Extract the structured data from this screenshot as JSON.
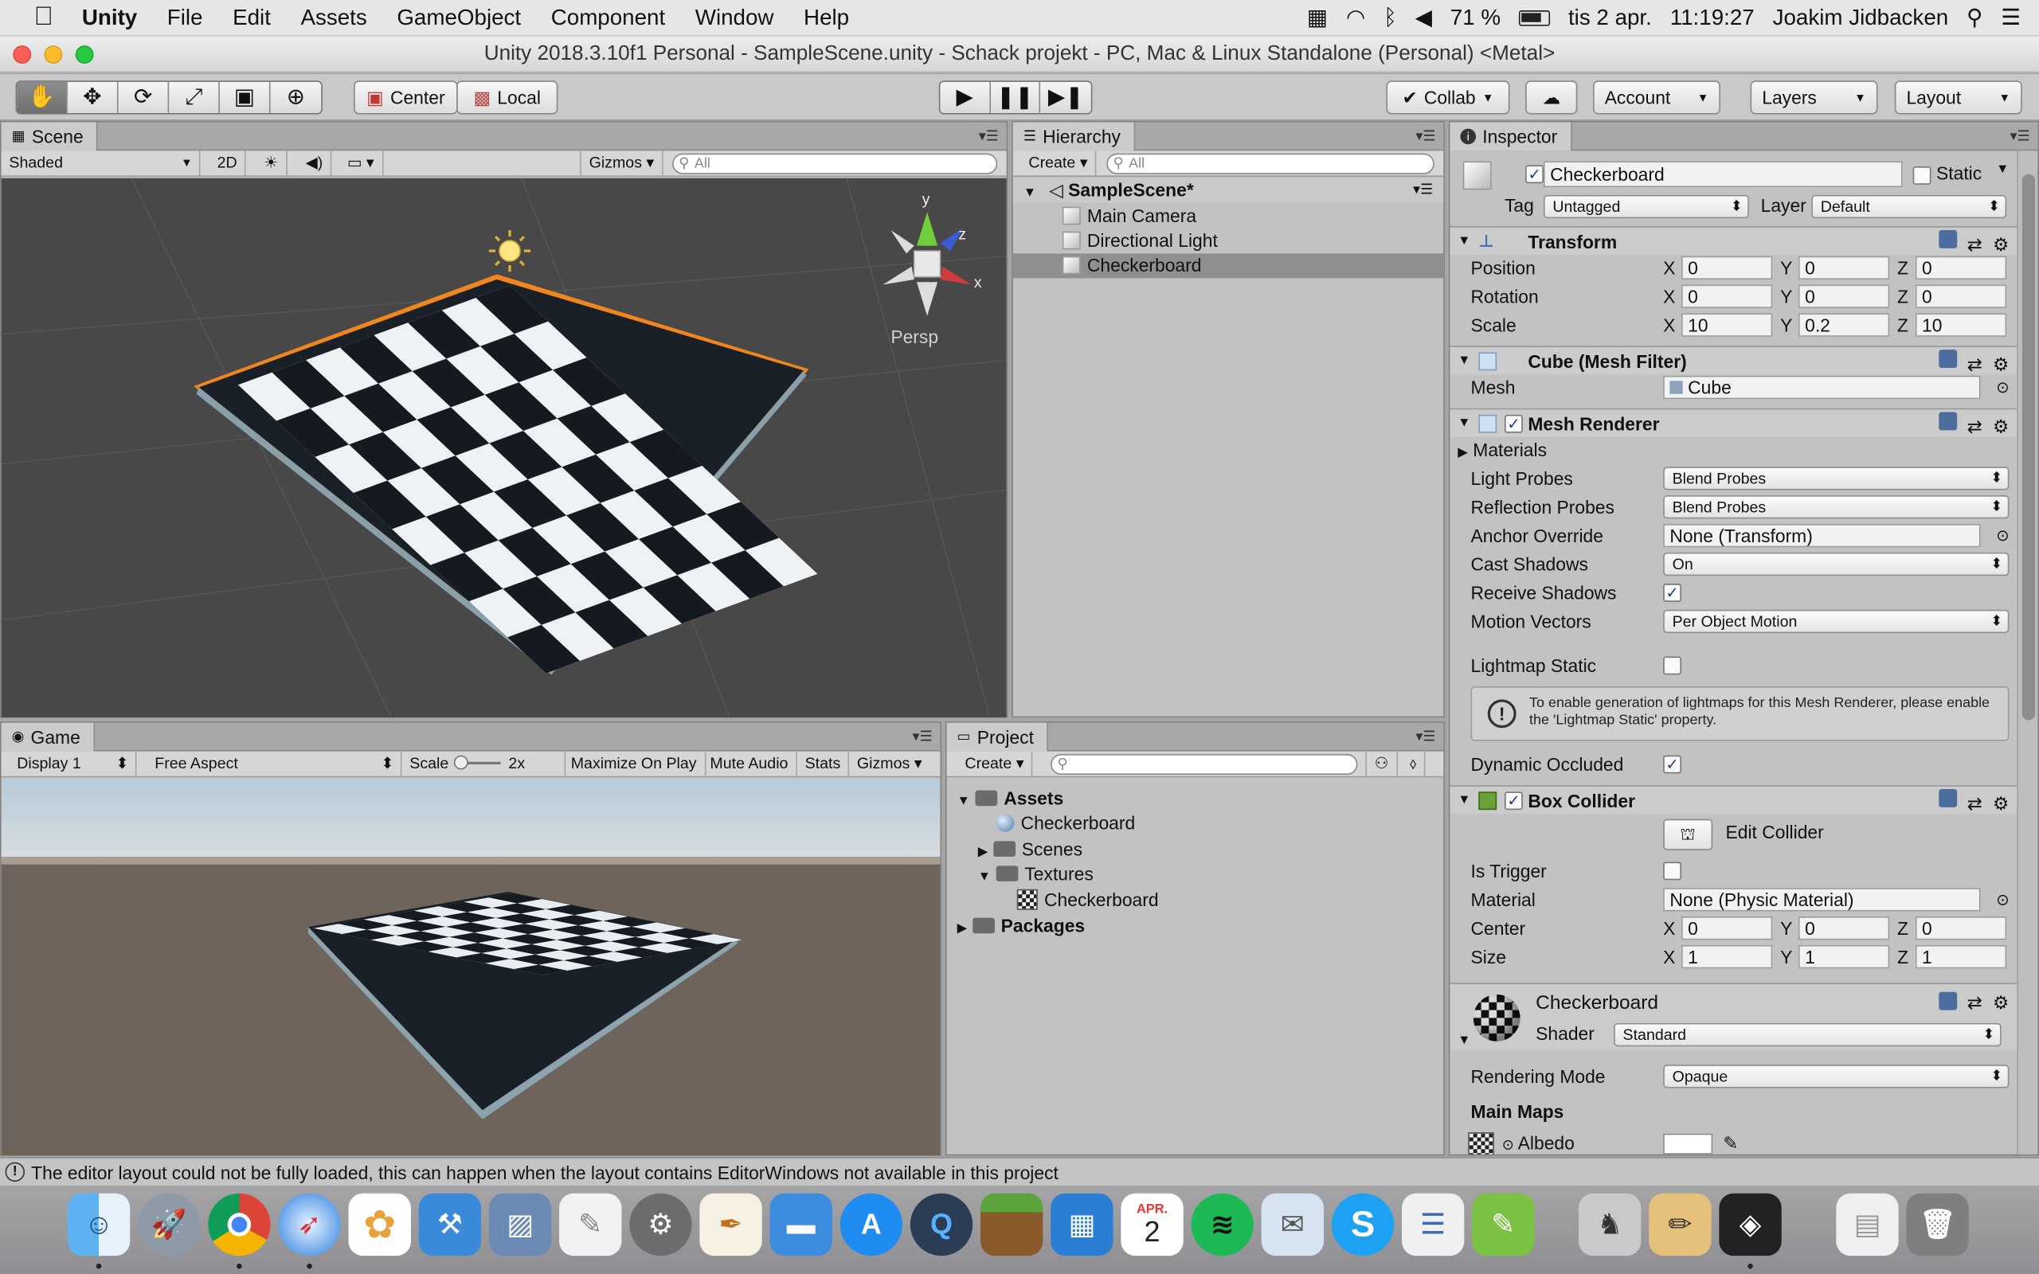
{
  "menubar": {
    "app": "Unity",
    "items": [
      "File",
      "Edit",
      "Assets",
      "GameObject",
      "Component",
      "Window",
      "Help"
    ],
    "battery": "71 %",
    "date": "tis 2 apr.",
    "time": "11:19:27",
    "user": "Joakim Jidbacken"
  },
  "window_title": "Unity 2018.3.10f1 Personal - SampleScene.unity - Schack projekt - PC, Mac & Linux Standalone (Personal) <Metal>",
  "toolbar": {
    "center": "Center",
    "local": "Local",
    "collab": "Collab",
    "account": "Account",
    "layers": "Layers",
    "layout": "Layout"
  },
  "scene": {
    "tab": "Scene",
    "shading": "Shaded",
    "mode_2d": "2D",
    "gizmos": "Gizmos",
    "search_placeholder": "All",
    "persp": "Persp",
    "axis_x": "x",
    "axis_y": "y",
    "axis_z": "z"
  },
  "game": {
    "tab": "Game",
    "display": "Display 1",
    "aspect": "Free Aspect",
    "scale_label": "Scale",
    "scale_value": "2x",
    "maximize": "Maximize On Play",
    "mute": "Mute Audio",
    "stats": "Stats",
    "gizmos": "Gizmos"
  },
  "hierarchy": {
    "tab": "Hierarchy",
    "create": "Create",
    "search_placeholder": "All",
    "scene": "SampleScene*",
    "items": [
      "Main Camera",
      "Directional Light",
      "Checkerboard"
    ],
    "selected": "Checkerboard"
  },
  "project": {
    "tab": "Project",
    "create": "Create",
    "tree": [
      {
        "label": "Assets",
        "level": 0,
        "bold": true
      },
      {
        "label": "Checkerboard",
        "level": 1,
        "kind": "material"
      },
      {
        "label": "Scenes",
        "level": 1,
        "kind": "folder"
      },
      {
        "label": "Textures",
        "level": 1,
        "kind": "folder"
      },
      {
        "label": "Checkerboard",
        "level": 2,
        "kind": "texture"
      },
      {
        "label": "Packages",
        "level": 0,
        "bold": true
      }
    ]
  },
  "inspector": {
    "tab": "Inspector",
    "object_name": "Checkerboard",
    "static_label": "Static",
    "tag_label": "Tag",
    "tag": "Untagged",
    "layer_label": "Layer",
    "layer": "Default",
    "transform": {
      "title": "Transform",
      "position_label": "Position",
      "position": [
        "0",
        "0",
        "0"
      ],
      "rotation_label": "Rotation",
      "rotation": [
        "0",
        "0",
        "0"
      ],
      "scale_label": "Scale",
      "scale": [
        "10",
        "0.2",
        "10"
      ]
    },
    "mesh_filter": {
      "title": "Cube (Mesh Filter)",
      "mesh_label": "Mesh",
      "mesh": "Cube"
    },
    "mesh_renderer": {
      "title": "Mesh Renderer",
      "materials": "Materials",
      "light_probes_label": "Light Probes",
      "light_probes": "Blend Probes",
      "reflection_probes_label": "Reflection Probes",
      "reflection_probes": "Blend Probes",
      "anchor_override_label": "Anchor Override",
      "anchor_override": "None (Transform)",
      "cast_shadows_label": "Cast Shadows",
      "cast_shadows": "On",
      "receive_shadows_label": "Receive Shadows",
      "motion_vectors_label": "Motion Vectors",
      "motion_vectors": "Per Object Motion",
      "lightmap_static_label": "Lightmap Static",
      "info": "To enable generation of lightmaps for this Mesh Renderer, please enable the 'Lightmap Static' property.",
      "dynamic_occluded_label": "Dynamic Occluded"
    },
    "box_collider": {
      "title": "Box Collider",
      "edit_collider": "Edit Collider",
      "is_trigger_label": "Is Trigger",
      "material_label": "Material",
      "material": "None (Physic Material)",
      "center_label": "Center",
      "center": [
        "0",
        "0",
        "0"
      ],
      "size_label": "Size",
      "size": [
        "1",
        "1",
        "1"
      ]
    },
    "material": {
      "name": "Checkerboard",
      "shader_label": "Shader",
      "shader": "Standard",
      "rendering_mode_label": "Rendering Mode",
      "rendering_mode": "Opaque",
      "main_maps": "Main Maps",
      "albedo": "Albedo"
    },
    "axis": [
      "X",
      "Y",
      "Z"
    ]
  },
  "status": "The editor layout could not be fully loaded, this can happen when the layout contains EditorWindows not available in this project",
  "dock": {
    "calendar_month": "APR.",
    "calendar_day": "2"
  },
  "colors": {
    "selection_orange": "#f2861e",
    "sky_top": "#b8cbd9",
    "ground": "#6e645c",
    "scene_bg": "#484848"
  }
}
